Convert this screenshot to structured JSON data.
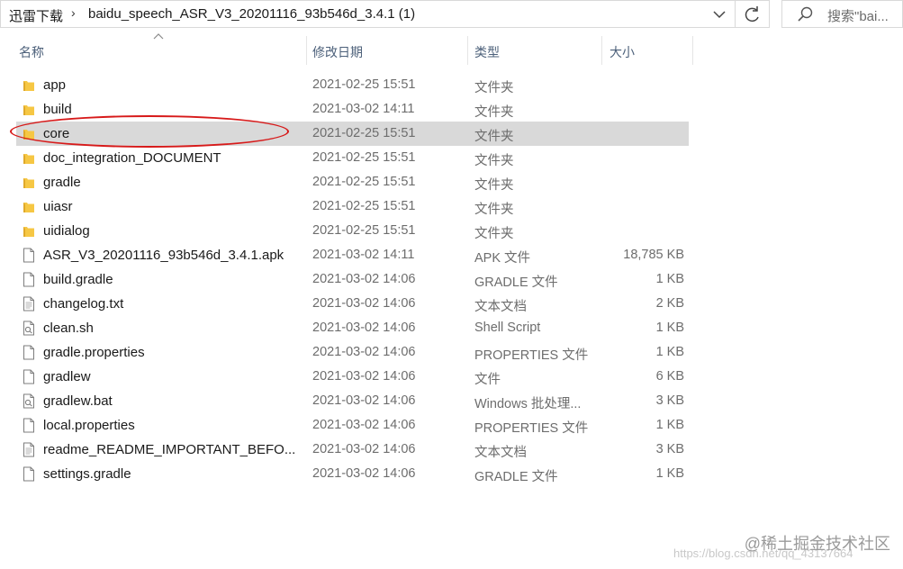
{
  "address_bar": {
    "crumbs": [
      "迅雷下载",
      "baidu_speech_ASR_V3_20201116_93b546d_3.4.1 (1)"
    ]
  },
  "search": {
    "placeholder": "搜索\"bai..."
  },
  "columns": {
    "name": "名称",
    "date": "修改日期",
    "type": "类型",
    "size": "大小"
  },
  "files": [
    {
      "name": "app",
      "date": "2021-02-25 15:51",
      "type": "文件夹",
      "size": "",
      "icon": "folder-icon"
    },
    {
      "name": "build",
      "date": "2021-03-02 14:11",
      "type": "文件夹",
      "size": "",
      "icon": "folder-icon"
    },
    {
      "name": "core",
      "date": "2021-02-25 15:51",
      "type": "文件夹",
      "size": "",
      "icon": "folder-icon",
      "selected": true
    },
    {
      "name": "doc_integration_DOCUMENT",
      "date": "2021-02-25 15:51",
      "type": "文件夹",
      "size": "",
      "icon": "folder-icon"
    },
    {
      "name": "gradle",
      "date": "2021-02-25 15:51",
      "type": "文件夹",
      "size": "",
      "icon": "folder-icon"
    },
    {
      "name": "uiasr",
      "date": "2021-02-25 15:51",
      "type": "文件夹",
      "size": "",
      "icon": "folder-icon"
    },
    {
      "name": "uidialog",
      "date": "2021-02-25 15:51",
      "type": "文件夹",
      "size": "",
      "icon": "folder-icon"
    },
    {
      "name": "ASR_V3_20201116_93b546d_3.4.1.apk",
      "date": "2021-03-02 14:11",
      "type": "APK 文件",
      "size": "18,785 KB",
      "icon": "file-icon"
    },
    {
      "name": "build.gradle",
      "date": "2021-03-02 14:06",
      "type": "GRADLE 文件",
      "size": "1 KB",
      "icon": "file-icon"
    },
    {
      "name": "changelog.txt",
      "date": "2021-03-02 14:06",
      "type": "文本文档",
      "size": "2 KB",
      "icon": "text-file-icon"
    },
    {
      "name": "clean.sh",
      "date": "2021-03-02 14:06",
      "type": "Shell Script",
      "size": "1 KB",
      "icon": "script-file-icon"
    },
    {
      "name": "gradle.properties",
      "date": "2021-03-02 14:06",
      "type": "PROPERTIES 文件",
      "size": "1 KB",
      "icon": "file-icon"
    },
    {
      "name": "gradlew",
      "date": "2021-03-02 14:06",
      "type": "文件",
      "size": "6 KB",
      "icon": "file-icon"
    },
    {
      "name": "gradlew.bat",
      "date": "2021-03-02 14:06",
      "type": "Windows 批处理...",
      "size": "3 KB",
      "icon": "script-file-icon"
    },
    {
      "name": "local.properties",
      "date": "2021-03-02 14:06",
      "type": "PROPERTIES 文件",
      "size": "1 KB",
      "icon": "file-icon"
    },
    {
      "name": "readme_README_IMPORTANT_BEFO...",
      "date": "2021-03-02 14:06",
      "type": "文本文档",
      "size": "3 KB",
      "icon": "text-file-icon"
    },
    {
      "name": "settings.gradle",
      "date": "2021-03-02 14:06",
      "type": "GRADLE 文件",
      "size": "1 KB",
      "icon": "file-icon"
    }
  ],
  "colors": {
    "selection": "#d9d9d9",
    "folder": "#f6c744",
    "annotation": "#d71a1a",
    "header_text": "#4c607a"
  },
  "watermark": "@稀土掘金技术社区",
  "watermark_url": "https://blog.csdn.net/qq_43137664"
}
